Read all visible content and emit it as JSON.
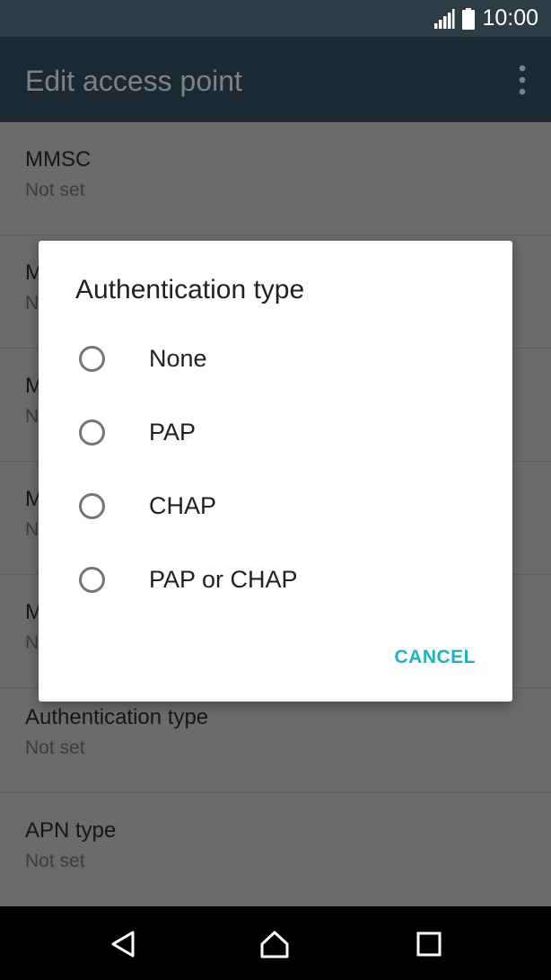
{
  "status_bar": {
    "time": "10:00",
    "icons": [
      "signal-icon",
      "battery-icon"
    ]
  },
  "app_bar": {
    "title": "Edit access point",
    "overflow_icon": "more-vert-icon"
  },
  "settings": {
    "items": [
      {
        "title": "MMSC",
        "subtitle": "Not set"
      },
      {
        "title": "M",
        "subtitle": "N"
      },
      {
        "title": "M",
        "subtitle": "N"
      },
      {
        "title": "M",
        "subtitle": "N"
      },
      {
        "title": "M",
        "subtitle": "N"
      },
      {
        "title": "Authentication type",
        "subtitle": "Not set"
      },
      {
        "title": "APN type",
        "subtitle": "Not set"
      }
    ]
  },
  "dialog": {
    "title": "Authentication type",
    "options": [
      {
        "label": "None",
        "selected": false
      },
      {
        "label": "PAP",
        "selected": false
      },
      {
        "label": "CHAP",
        "selected": false
      },
      {
        "label": "PAP or CHAP",
        "selected": false
      }
    ],
    "cancel_label": "CANCEL"
  },
  "nav_bar": {
    "icons": [
      "back-icon",
      "home-icon",
      "recents-icon"
    ]
  },
  "colors": {
    "accent": "#1fb3c0",
    "status_bar": "#2e3c46",
    "app_bar": "#1d2932",
    "scrim_background": "#6b6b6b"
  }
}
